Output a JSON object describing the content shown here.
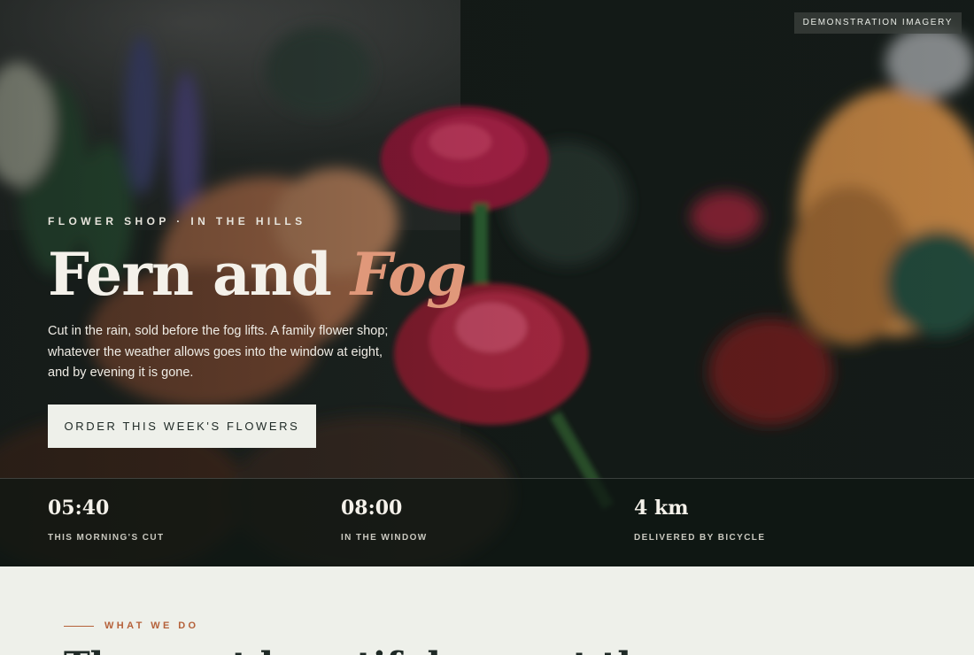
{
  "badge": "DEMONSTRATION IMAGERY",
  "hero": {
    "eyebrow": "FLOWER SHOP · IN THE HILLS",
    "title_main": "Fern and ",
    "title_accent": "Fog",
    "lede": "Cut in the rain, sold before the fog lifts. A family flower shop; whatever the weather allows goes into the window at eight, and by evening it is gone.",
    "cta_label": "ORDER THIS WEEK'S FLOWERS"
  },
  "stats": [
    {
      "value": "05:40",
      "label": "THIS MORNING'S CUT"
    },
    {
      "value": "08:00",
      "label": "IN THE WINDOW"
    },
    {
      "value": "4 km",
      "label": "DELIVERED BY BICYCLE"
    }
  ],
  "section": {
    "eyebrow": "WHAT WE DO",
    "heading": "The most beautiful one, at the"
  },
  "colors": {
    "accent": "#e0987a",
    "section_accent": "#b5613a",
    "dark": "#1f2a26",
    "light": "#eef0ea"
  }
}
